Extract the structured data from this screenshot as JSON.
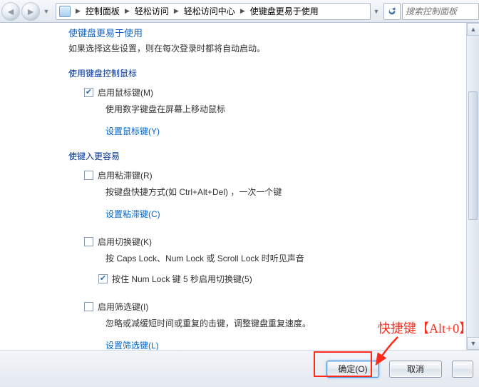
{
  "breadcrumb": {
    "items": [
      "控制面板",
      "轻松访问",
      "轻松访问中心",
      "使键盘更易于使用"
    ]
  },
  "search": {
    "placeholder": "搜索控制面板"
  },
  "intro": {
    "title_partial": "使键盘更易于使用",
    "note": "如果选择这些设置，则在每次登录时都将自动启动。"
  },
  "mouse_section": {
    "heading": "使用键盘控制鼠标",
    "enable_label": "启用鼠标键(M)",
    "enable_checked": true,
    "desc": "使用数字键盘在屏幕上移动鼠标",
    "link": "设置鼠标键(Y)"
  },
  "typing_section": {
    "heading": "使键入更容易",
    "sticky": {
      "label": "启用粘滞键(R)",
      "checked": false,
      "desc": "按键盘快捷方式(如 Ctrl+Alt+Del) ，一次一个键",
      "link": "设置粘滞键(C)"
    },
    "toggle": {
      "label": "启用切换键(K)",
      "checked": false,
      "desc": "按 Caps Lock、Num Lock 或 Scroll Lock 时听见声音",
      "hold_label": "按住 Num Lock 键 5 秒启用切换键(5)",
      "hold_checked": true
    },
    "filter": {
      "label": "启用筛选键(I)",
      "checked": false,
      "desc": "忽略或减缓短时间或重复的击键，调整键盘重复速度。",
      "link": "设置筛选键(L)"
    }
  },
  "buttons": {
    "ok": "确定(O)",
    "cancel": "取消"
  },
  "annotation": {
    "text": "快捷键【Alt+0】"
  }
}
